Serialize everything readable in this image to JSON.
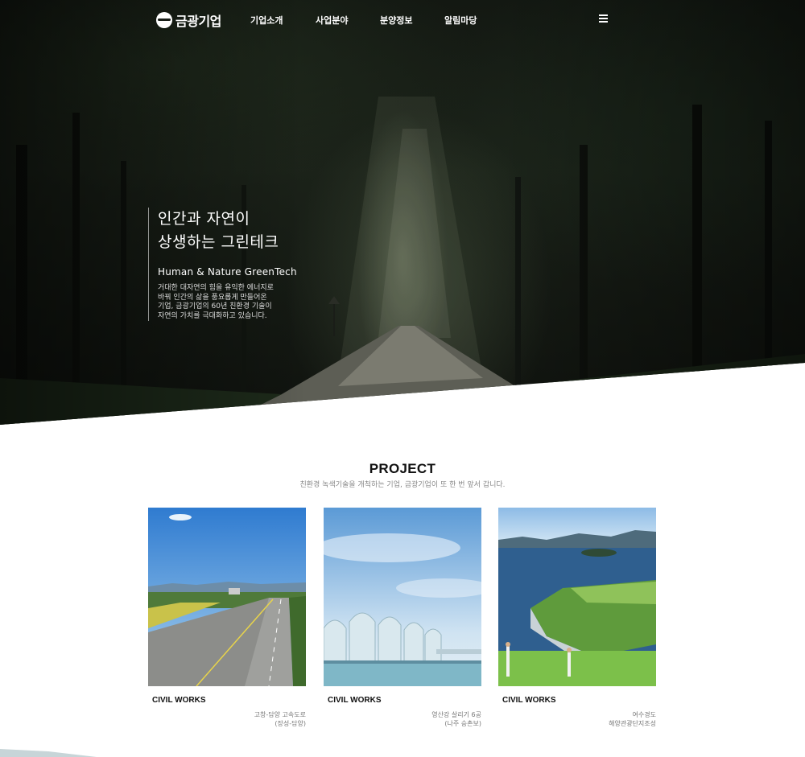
{
  "brand": {
    "name": "금광기업"
  },
  "nav": {
    "items": [
      {
        "label": "기업소개"
      },
      {
        "label": "사업분야"
      },
      {
        "label": "분양정보"
      },
      {
        "label": "알림마당"
      }
    ],
    "menu_icon": "hamburger-icon"
  },
  "hero": {
    "title_line1": "인간과 자연이",
    "title_line2": "상생하는 그린테크",
    "subtitle": "Human & Nature GreenTech",
    "desc_line1": "거대한 대자연의 힘을 유익한 에너지로",
    "desc_line2": "바꿔 인간의 삶을 풍요롭게 만들어온",
    "desc_line3": "기업, 금광기업의 60년 친환경 기술이",
    "desc_line4": "자연의 가치를 극대화하고 있습니다."
  },
  "project": {
    "title": "PROJECT",
    "description": "친환경 녹색기술을 개척하는 기업, 금광기업이 또 한 번 앞서 갑니다.",
    "cards": [
      {
        "category": "CIVIL WORKS",
        "loc_line1": "고창-담양 고속도로",
        "loc_line2": "(장성-담양)"
      },
      {
        "category": "CIVIL WORKS",
        "loc_line1": "영산강 살리기 6공",
        "loc_line2": "(나주 승촌보)"
      },
      {
        "category": "CIVIL WORKS",
        "loc_line1": "여수경도",
        "loc_line2": "해양관광단지조성"
      }
    ]
  },
  "colors": {
    "accent": "#111111",
    "muted": "#888888",
    "hero_dark": "#131812"
  }
}
